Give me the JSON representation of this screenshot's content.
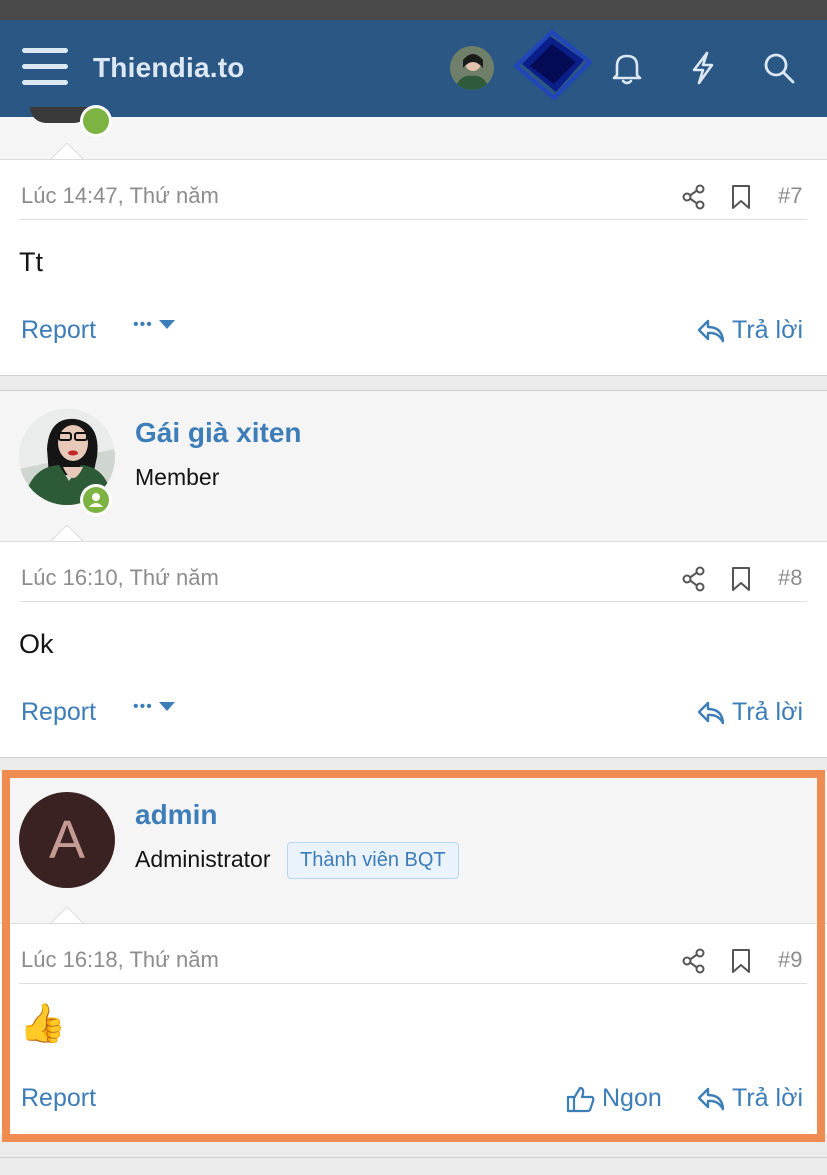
{
  "header": {
    "site_name": "Thiendia.to",
    "icons": [
      "menu-icon",
      "user-avatar",
      "bell-icon",
      "bolt-icon",
      "search-icon"
    ],
    "bg_color": "#2b5785"
  },
  "posts": [
    {
      "date": "Lúc 14:47, Thứ năm",
      "number": "#7",
      "content": "Tt",
      "actions": {
        "report": "Report",
        "more": "•••",
        "reply": "Trả lời"
      }
    },
    {
      "user": {
        "name": "Gái già xiten",
        "title": "Member"
      },
      "date": "Lúc 16:10, Thứ năm",
      "number": "#8",
      "content": "Ok",
      "actions": {
        "report": "Report",
        "more": "•••",
        "reply": "Trả lời"
      }
    },
    {
      "user": {
        "name": "admin",
        "initial": "A",
        "title": "Administrator",
        "badge": "Thành viên BQT"
      },
      "date": "Lúc 16:18, Thứ năm",
      "number": "#9",
      "content": "👍",
      "actions": {
        "report": "Report",
        "like": "Ngon",
        "reply": "Trả lời"
      }
    }
  ],
  "colors": {
    "link": "#3d7db8",
    "highlight": "#ee8c52",
    "online": "#7cb342"
  }
}
